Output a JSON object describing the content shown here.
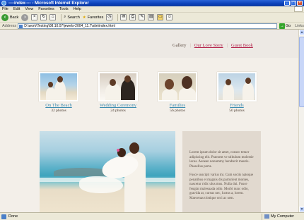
{
  "window": {
    "title": "----index---- - Microsoft Internet Explorer"
  },
  "menu": [
    "File",
    "Edit",
    "View",
    "Favorites",
    "Tools",
    "Help"
  ],
  "toolbar": {
    "back": "Back",
    "search": "Search",
    "favorites": "Favorites"
  },
  "address": {
    "label": "Address",
    "value": "D:\\work\\Testing\\08.10.07\\jewels-2004_11.7\\site\\index.html",
    "go": "Go",
    "links": "Links"
  },
  "nav": {
    "items": [
      {
        "label": "Gallery",
        "active": false
      },
      {
        "label": "Our Love Story",
        "active": true
      },
      {
        "label": "Guest Book",
        "active": true
      }
    ]
  },
  "gallery": [
    {
      "title": "On The Beach",
      "count": "32 photos"
    },
    {
      "title": "Wedding Ceremony",
      "count": "24 photos"
    },
    {
      "title": "Families",
      "count": "56 photos"
    },
    {
      "title": "Friends",
      "count": "50 photos"
    }
  ],
  "text_panel": {
    "p1": "Lorem ipsum dolor sit amet, consec tetuer adipiscing elit. Praesent ve stibulum molestie lacus. Aenean nonummy hendrerit mauris. Phasellus porta.",
    "p2": "Fusce suscipit varius mi. Cum sociis natoque penatibus et magnis dis parturient montes, nascetur ridic ulus mus. Nulla dui. Fusce feugiat malesuada odio. Morbi nunc odio, gravida at, cursus nec, luctus a, lorem. Maecenas tristique orci ac sem."
  },
  "status": {
    "left": "Done",
    "zone": "My Computer"
  }
}
